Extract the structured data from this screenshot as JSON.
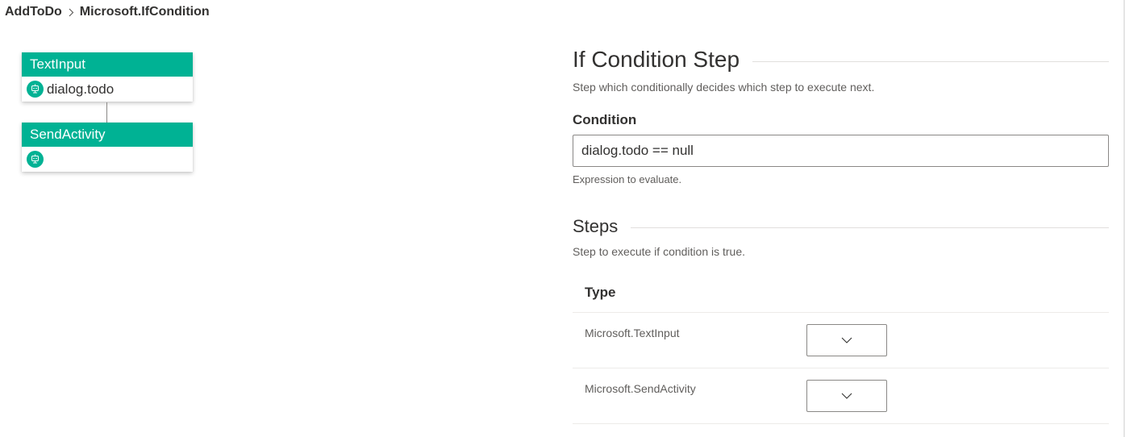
{
  "breadcrumb": {
    "items": [
      "AddToDo",
      "Microsoft.IfCondition"
    ]
  },
  "canvas": {
    "nodes": [
      {
        "title": "TextInput",
        "body": "dialog.todo",
        "icon": "bot-icon"
      },
      {
        "title": "SendActivity",
        "body": "",
        "icon": "bot-icon"
      }
    ],
    "accent_color": "#00b294"
  },
  "form": {
    "title": "If Condition Step",
    "description": "Step which conditionally decides which step to execute next.",
    "condition": {
      "label": "Condition",
      "value": "dialog.todo == null",
      "help": "Expression to evaluate."
    },
    "steps": {
      "title": "Steps",
      "description": "Step to execute if condition is true.",
      "column_header": "Type",
      "rows": [
        {
          "type": "Microsoft.TextInput",
          "selected": ""
        },
        {
          "type": "Microsoft.SendActivity",
          "selected": ""
        }
      ]
    }
  }
}
